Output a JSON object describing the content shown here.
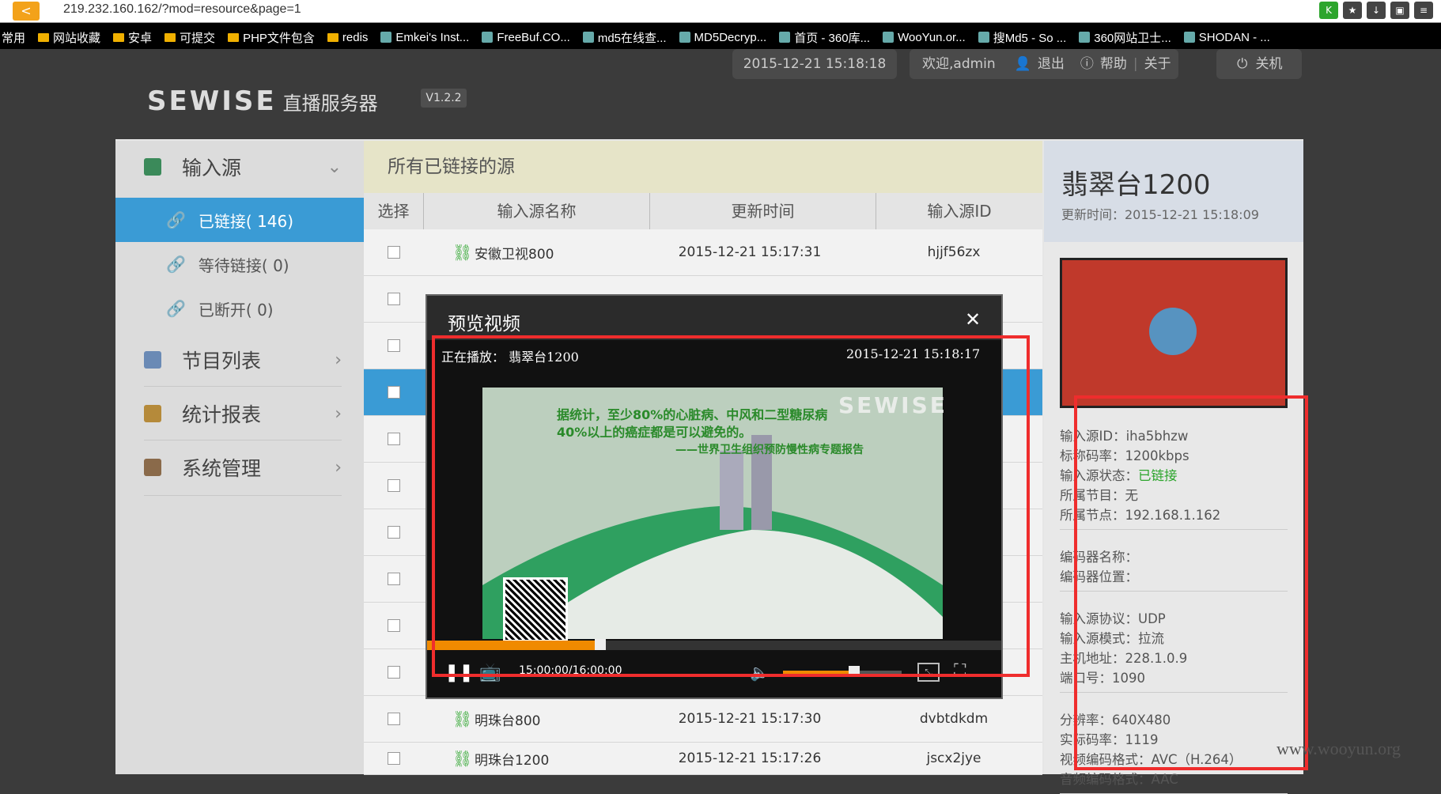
{
  "browser": {
    "url": "219.232.160.162/?mod=resource&page=1",
    "bookmarks": [
      "常用",
      "网站收藏",
      "安卓",
      "可提交",
      "PHP文件包含",
      "redis",
      "Emkei's Inst...",
      "FreeBuf.CO...",
      "md5在线查...",
      "MD5Decryp...",
      "首页 - 360库...",
      "WooYun.or...",
      "搜Md5 - So ...",
      "360网站卫士...",
      "SHODAN - ..."
    ]
  },
  "header": {
    "logo": "SEWISE",
    "logo_sub": "直播服务器",
    "version": "V1.2.2",
    "datetime": "2015-12-21 15:18:18",
    "welcome": "欢迎,admin",
    "logout": "退出",
    "help": "帮助",
    "about": "关于",
    "shutdown": "关机"
  },
  "sidebar": {
    "input_source": "输入源",
    "linked": "已链接( 146)",
    "waiting": "等待链接( 0)",
    "disconnected": "已断开( 0)",
    "program_list": "节目列表",
    "stats": "统计报表",
    "system": "系统管理"
  },
  "table": {
    "title": "所有已链接的源",
    "headers": [
      "选择",
      "输入源名称",
      "更新时间",
      "输入源ID"
    ],
    "rows": [
      {
        "name": "安徽卫视800",
        "time": "2015-12-21 15:17:31",
        "id": "hjjf56zx"
      },
      {
        "name": "明珠台800",
        "time": "2015-12-21 15:17:30",
        "id": "dvbtdkdm"
      },
      {
        "name": "明珠台1200",
        "time": "2015-12-21 15:17:26",
        "id": "jscx2jye"
      }
    ]
  },
  "info": {
    "name": "翡翠台1200",
    "updated": "更新时间：2015-12-21 15:18:09",
    "lines1": [
      {
        "label": "输入源ID：",
        "value": "iha5bhzw"
      },
      {
        "label": "标称码率：",
        "value": "1200kbps"
      },
      {
        "label": "输入源状态：",
        "value": "已链接",
        "green": true
      },
      {
        "label": "所属节目：",
        "value": "无"
      },
      {
        "label": "所属节点：",
        "value": "192.168.1.162"
      }
    ],
    "lines2": [
      {
        "label": "编码器名称：",
        "value": ""
      },
      {
        "label": "编码器位置：",
        "value": ""
      }
    ],
    "lines3": [
      {
        "label": "输入源协议：",
        "value": "UDP"
      },
      {
        "label": "输入源模式：",
        "value": "拉流"
      },
      {
        "label": "主机地址：",
        "value": "228.1.0.9"
      },
      {
        "label": "端口号：",
        "value": "1090"
      }
    ],
    "lines4": [
      {
        "label": "分辨率：",
        "value": "640X480"
      },
      {
        "label": "实际码率：",
        "value": "1119"
      },
      {
        "label": "视频编码格式：",
        "value": "AVC（H.264）"
      },
      {
        "label": "音频编码格式：",
        "value": "AAC"
      }
    ]
  },
  "modal": {
    "title": "预览视频",
    "now_playing": "正在播放：  翡翠台1200",
    "time": "2015-12-21  15:18:17",
    "video_text_1": "据统计，至少80%的心脏病、中风和二型糖尿病",
    "video_text_2": "40%以上的癌症都是可以避免的。",
    "video_text_3": "——世界卫生组织预防慢性病专题报告",
    "video_logo": "SEWISE",
    "timecode": "15:00:00/16:00:00",
    "progress": 0.3,
    "volume": 0.6
  },
  "watermark": "www.wooyun.org"
}
